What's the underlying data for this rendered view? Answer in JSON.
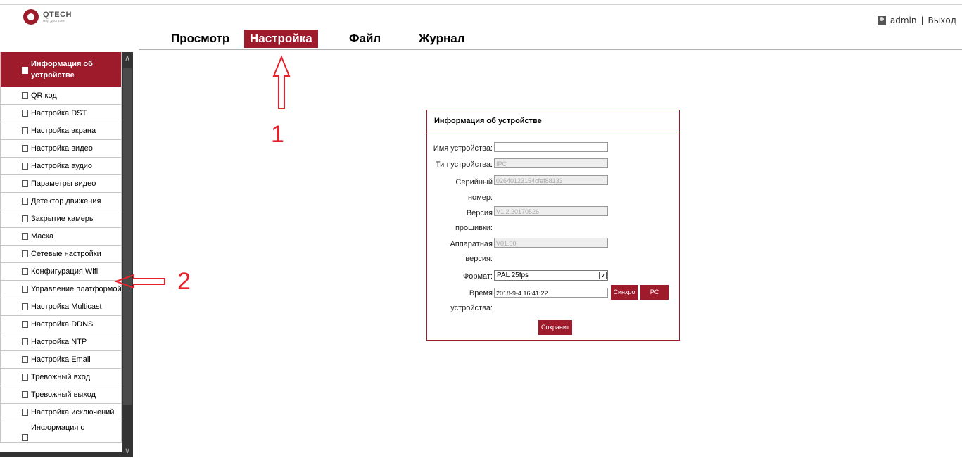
{
  "brand": {
    "name": "QTECH",
    "tagline": "мир доступен"
  },
  "user": {
    "name": "admin",
    "separator": "|",
    "logout": "Выход"
  },
  "nav": [
    {
      "label": "Просмотр",
      "active": false
    },
    {
      "label": "Настройка",
      "active": true
    },
    {
      "label": "Файл",
      "active": false
    },
    {
      "label": "Журнал",
      "active": false
    }
  ],
  "sidebar": {
    "items": [
      {
        "label": "Информация об устройстве",
        "active": true
      },
      {
        "label": "QR код"
      },
      {
        "label": "Настройка DST"
      },
      {
        "label": "Настройка экрана"
      },
      {
        "label": "Настройка видео"
      },
      {
        "label": "Настройка аудио"
      },
      {
        "label": "Параметры видео"
      },
      {
        "label": "Детектор движения"
      },
      {
        "label": "Закрытие камеры"
      },
      {
        "label": "Маска"
      },
      {
        "label": "Сетевые настройки"
      },
      {
        "label": "Конфигурация Wifi"
      },
      {
        "label": "Управление платформой"
      },
      {
        "label": "Настройка Multicast"
      },
      {
        "label": "Настройка DDNS"
      },
      {
        "label": "Настройка NTP"
      },
      {
        "label": "Настройка Email"
      },
      {
        "label": "Тревожный вход"
      },
      {
        "label": "Тревожный выход"
      },
      {
        "label": "Настройка исключений"
      },
      {
        "label": "Информация о"
      }
    ]
  },
  "annotations": {
    "one": "1",
    "two": "2"
  },
  "panel": {
    "title": "Информация об устройстве",
    "device_name": {
      "label": "Имя устройства:",
      "value": ""
    },
    "device_type": {
      "label": "Тип устройства:",
      "value": "IPC"
    },
    "serial": {
      "label1": "Серийный",
      "label2": "номер:",
      "value": "02640123154cfef88133"
    },
    "firmware": {
      "label1": "Версия",
      "label2": "прошивки:",
      "value": "V1.2.20170526"
    },
    "hardware": {
      "label1": "Аппаратная",
      "label2": "версия:",
      "value": "V01.00"
    },
    "format": {
      "label": "Формат:",
      "value": "PAL 25fps"
    },
    "time": {
      "label1": "Время",
      "label2": "устройства:",
      "value": "2018-9-4 16:41:22"
    },
    "sync_button": "Синхро",
    "pc_button": "PC",
    "save_button": "Сохранит"
  },
  "colors": {
    "accent": "#9e1b2c",
    "annotation": "#e8202a"
  }
}
